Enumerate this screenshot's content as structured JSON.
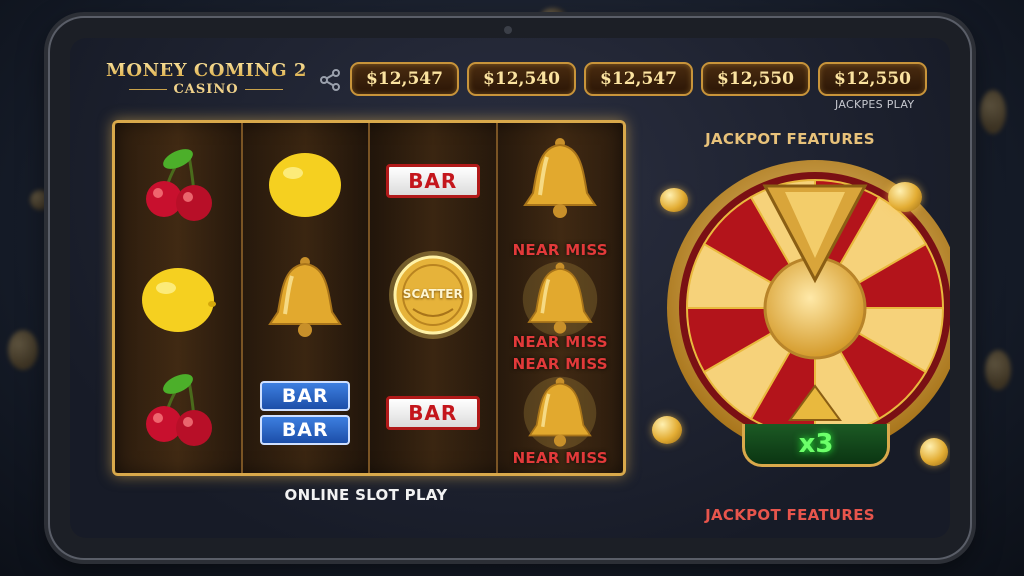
{
  "brand": {
    "title": "MONEY COMING 2",
    "subtitle": "CASINO"
  },
  "header": {
    "share_icon": "share-icon",
    "jackpots": [
      "$12,547",
      "$12,540",
      "$12,547",
      "$12,550",
      "$12,550"
    ],
    "jackpots_caption": "JACKPES PLAY"
  },
  "reels": {
    "columns": [
      [
        "cherry",
        "lemon",
        "cherry"
      ],
      [
        "lemon",
        "bell",
        "double-bar-blue"
      ],
      [
        "bar",
        "scatter-coin",
        "bar"
      ],
      [
        "bell",
        "bell",
        "bell"
      ]
    ],
    "bar_label": "BAR",
    "scatter_label": "SCATTER",
    "near_miss_labels": [
      "NEAR MISS",
      "NEAR MISS",
      "NEAR MISS",
      "NEAR MISS"
    ],
    "caption": "ONLINE SLOT PLAY"
  },
  "wheel": {
    "title": "JACKPOT FEATURES",
    "multiplier": "x3",
    "caption": "JACKPOT FEATURES",
    "colors": {
      "gold": "#e9b93e",
      "red": "#b3141b",
      "cream": "#f6d27a"
    }
  }
}
